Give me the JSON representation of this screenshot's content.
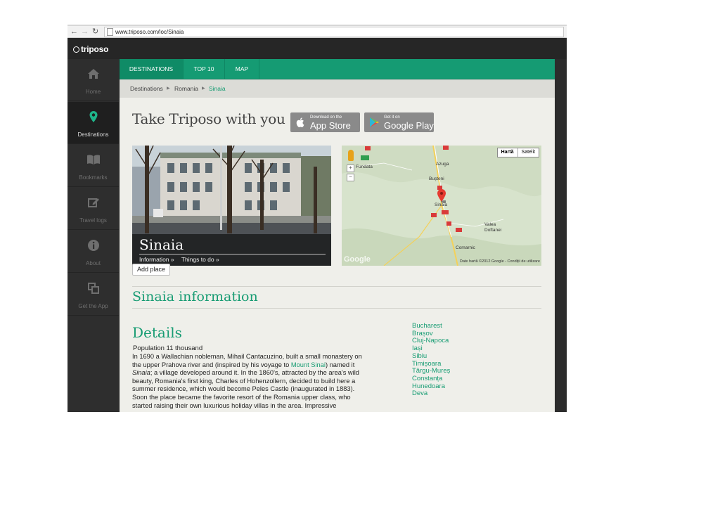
{
  "browser": {
    "back_icon": "back-arrow-icon",
    "forward_icon": "forward-arrow-icon",
    "reload_icon": "reload-icon",
    "url": "www.triposo.com/loc/Sinaia"
  },
  "app": {
    "logo": "triposo",
    "colors": {
      "accent": "#159b73",
      "sidebar": "#2e2e2e",
      "content_bg": "#efefea"
    }
  },
  "sidebar": {
    "items": [
      {
        "label": "Home",
        "icon": "home-icon"
      },
      {
        "label": "Destinations",
        "icon": "map-pin-icon"
      },
      {
        "label": "Bookmarks",
        "icon": "book-icon"
      },
      {
        "label": "Travel logs",
        "icon": "edit-icon"
      },
      {
        "label": "About",
        "icon": "info-icon"
      },
      {
        "label": "Get the App",
        "icon": "copy-icon"
      }
    ],
    "active": "Destinations"
  },
  "tabs": [
    {
      "label": "DESTINATIONS"
    },
    {
      "label": "TOP 10"
    },
    {
      "label": "MAP"
    }
  ],
  "breadcrumb": [
    "Destinations",
    "Romania",
    "Sinaia"
  ],
  "promo": {
    "title": "Take Triposo with you",
    "appstore": {
      "small": "Download on the",
      "big": "App Store"
    },
    "googleplay": {
      "small": "Get it on",
      "big": "Google Play"
    }
  },
  "photo": {
    "title": "Sinaia",
    "links": [
      "Information »",
      "Things to do »"
    ]
  },
  "add_place": "Add place",
  "map": {
    "type_buttons": [
      "Hartă",
      "Satelit"
    ],
    "labels": [
      "Fundata",
      "Azuga",
      "Bușteni",
      "Sinaia",
      "Valea Doftanei",
      "Comarnic"
    ],
    "google": "Google",
    "credit": "Date hartă ©2012 Google - Condiții de utilizare"
  },
  "section_title": "Sinaia information",
  "details": {
    "title": "Details",
    "population": "Population 11 thousand",
    "body_1": "In 1690 a Wallachian nobleman, Mihail Cantacuzino, built a small monastery on the upper Prahova river and (inspired by his voyage to ",
    "body_link": "Mount Sinai",
    "body_2": ") named it ",
    "body_em": "Sinaia",
    "body_3": "; a village developed around it. In the 1860's, attracted by the area's wild beauty, Romania's first king, Charles of Hohenzollern, decided to build here a summer residence, which would become Peles Castle (inaugurated in 1883). Soon the place became the favorite resort of the Romania upper class, who started raising their own luxurious holiday villas in the area. Impressive"
  },
  "cities": [
    "Bucharest",
    "Brașov",
    "Cluj-Napoca",
    "Iași",
    "Sibiu",
    "Timișoara",
    "Târgu-Mureș",
    "Constanța",
    "Hunedoara",
    "Deva"
  ]
}
